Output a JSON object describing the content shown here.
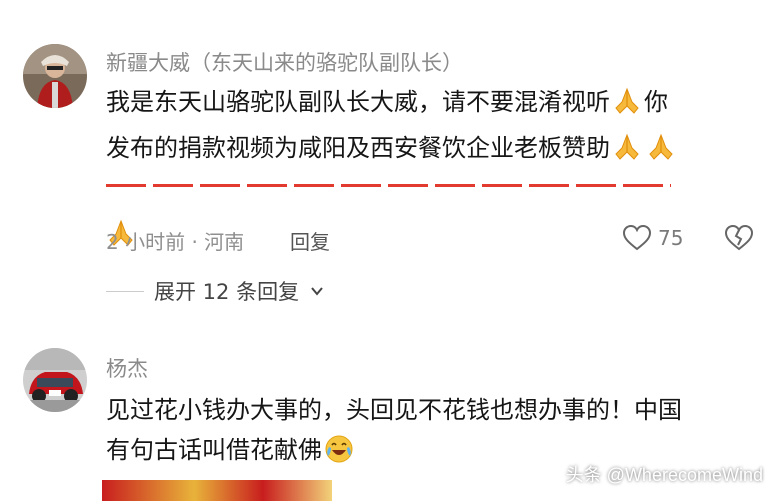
{
  "comments": [
    {
      "author": "新疆大威（东天山来的骆驼队副队长）",
      "text_line1": "我是东天山骆驼队副队长大威，请不要混淆视听",
      "text_line1_end": "你",
      "text_line2": "发布的捐款视频为咸阳及西安餐饮企业老板赞助",
      "time_location": "2 小时前 · 河南",
      "reply_label": "回复",
      "likes": "75",
      "expand_label": "展开 12 条回复"
    },
    {
      "author": "杨杰",
      "text_line1": "见过花小钱办大事的，头回见不花钱也想办事的！中国",
      "text_line2": "有句古话叫借花献佛"
    }
  ],
  "watermark": "头条 @WherecomeWind",
  "icons": {
    "pray": "pray-emoji-icon",
    "laugh_cry": "laugh-cry-emoji-icon",
    "heart": "heart-outline-icon",
    "broken_heart": "broken-heart-icon",
    "chevron": "chevron-down-icon"
  },
  "colors": {
    "divider_red": "#e23a2e",
    "meta_gray": "#8f8f8f"
  }
}
